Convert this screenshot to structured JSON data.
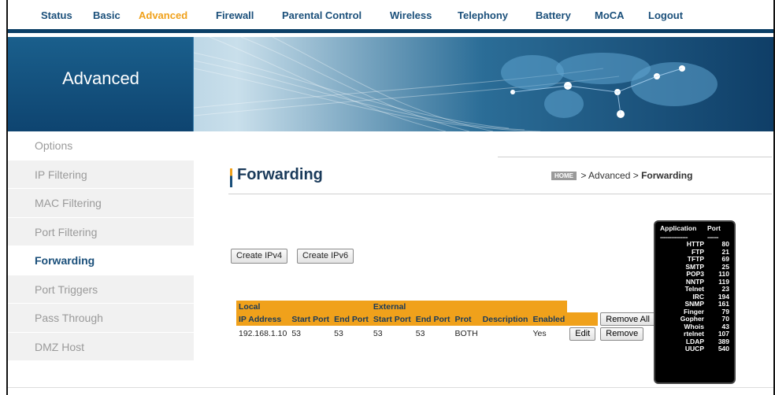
{
  "nav": {
    "items": [
      {
        "label": "Status",
        "name": "nav-status",
        "active": false
      },
      {
        "label": "Basic",
        "name": "nav-basic",
        "active": false
      },
      {
        "label": "Advanced",
        "name": "nav-advanced",
        "active": true
      },
      {
        "label": "Firewall",
        "name": "nav-firewall",
        "active": false
      },
      {
        "label": "Parental Control",
        "name": "nav-parental-control",
        "active": false
      },
      {
        "label": "Wireless",
        "name": "nav-wireless",
        "active": false
      },
      {
        "label": "Telephony",
        "name": "nav-telephony",
        "active": false
      },
      {
        "label": "Battery",
        "name": "nav-battery",
        "active": false
      },
      {
        "label": "MoCA",
        "name": "nav-moca",
        "active": false
      },
      {
        "label": "Logout",
        "name": "nav-logout",
        "active": false
      }
    ]
  },
  "banner": {
    "title": "Advanced"
  },
  "sidebar": {
    "items": [
      {
        "label": "Options",
        "name": "sidebar-item-options"
      },
      {
        "label": "IP Filtering",
        "name": "sidebar-item-ip-filtering"
      },
      {
        "label": "MAC Filtering",
        "name": "sidebar-item-mac-filtering"
      },
      {
        "label": "Port Filtering",
        "name": "sidebar-item-port-filtering"
      },
      {
        "label": "Forwarding",
        "name": "sidebar-item-forwarding"
      },
      {
        "label": "Port Triggers",
        "name": "sidebar-item-port-triggers"
      },
      {
        "label": "Pass Through",
        "name": "sidebar-item-pass-through"
      },
      {
        "label": "DMZ Host",
        "name": "sidebar-item-dmz-host"
      }
    ]
  },
  "page": {
    "title": "Forwarding",
    "breadcrumb": {
      "home": "HOME",
      "sep1": " > ",
      "section": "Advanced",
      "sep2": " > ",
      "current": "Forwarding"
    }
  },
  "buttons": {
    "create_ipv4": "Create IPv4",
    "create_ipv6": "Create IPv6"
  },
  "table": {
    "group_headers": {
      "local": "Local",
      "external": "External"
    },
    "columns": {
      "ip_address": "IP Address",
      "local_start": "Start Port",
      "local_end": "End Port",
      "ext_start": "Start Port",
      "ext_end": "End Port",
      "protocol": "Prot",
      "description": "Description",
      "enabled": "Enabled",
      "remove_all": "Remove All"
    },
    "rows": [
      {
        "ip_address": "192.168.1.10",
        "local_start": "53",
        "local_end": "53",
        "ext_start": "53",
        "ext_end": "53",
        "protocol": "BOTH",
        "description": "",
        "enabled": "Yes",
        "edit": "Edit",
        "remove": "Remove"
      }
    ]
  },
  "ports_ref": {
    "header_app": "Application",
    "header_port": "Port",
    "dash_app": "---------------",
    "dash_port": "------",
    "entries": [
      {
        "app": "HTTP",
        "port": "80"
      },
      {
        "app": "FTP",
        "port": "21"
      },
      {
        "app": "TFTP",
        "port": "69"
      },
      {
        "app": "SMTP",
        "port": "25"
      },
      {
        "app": "POP3",
        "port": "110"
      },
      {
        "app": "NNTP",
        "port": "119"
      },
      {
        "app": "Telnet",
        "port": "23"
      },
      {
        "app": "IRC",
        "port": "194"
      },
      {
        "app": "SNMP",
        "port": "161"
      },
      {
        "app": "Finger",
        "port": "79"
      },
      {
        "app": "Gopher",
        "port": "70"
      },
      {
        "app": "Whois",
        "port": "43"
      },
      {
        "app": "rtelnet",
        "port": "107"
      },
      {
        "app": "LDAP",
        "port": "389"
      },
      {
        "app": "UUCP",
        "port": "540"
      }
    ]
  },
  "colors": {
    "accent": "#f0a11b",
    "brand": "#1a4f7a",
    "banner_dark": "#0e4470"
  }
}
